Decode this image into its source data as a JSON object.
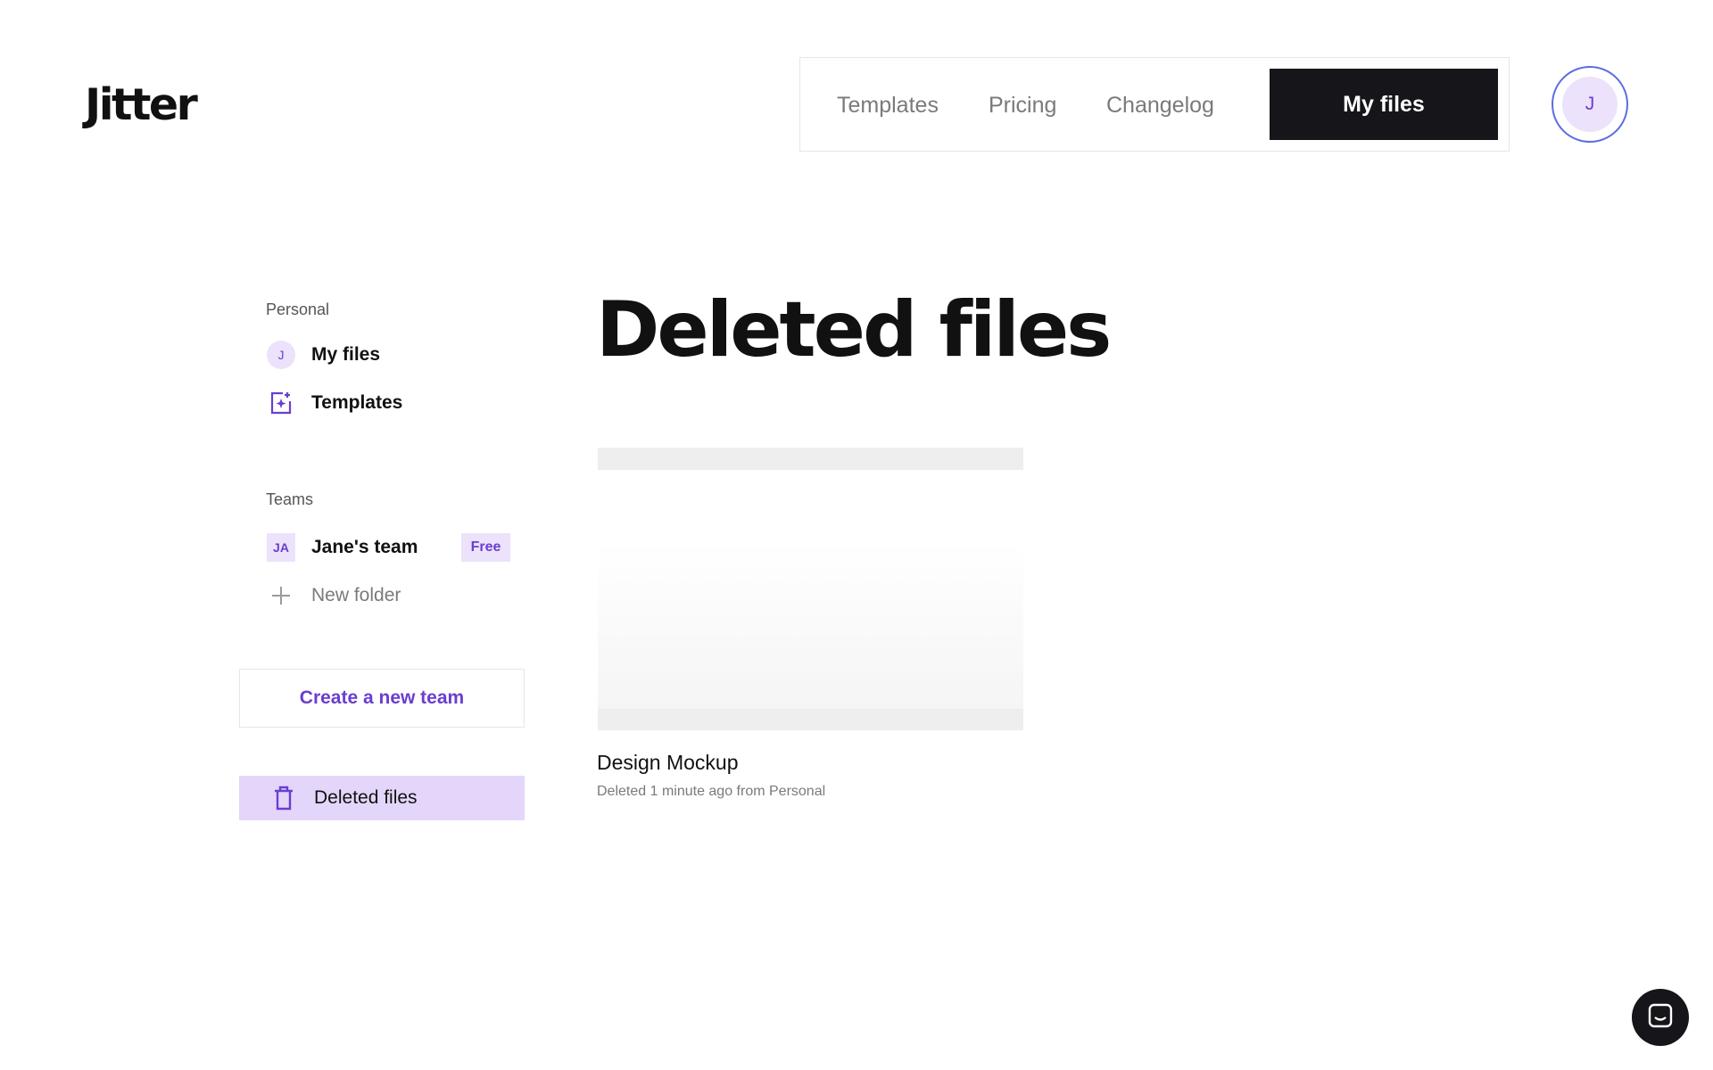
{
  "header": {
    "logo": "Jitter",
    "nav": {
      "templates": "Templates",
      "pricing": "Pricing",
      "changelog": "Changelog",
      "my_files": "My files"
    },
    "avatar_initial": "J"
  },
  "sidebar": {
    "personal_label": "Personal",
    "my_files": {
      "initial": "J",
      "label": "My files"
    },
    "templates": {
      "label": "Templates"
    },
    "teams_label": "Teams",
    "team": {
      "initials": "JA",
      "label": "Jane's team",
      "badge": "Free"
    },
    "new_folder": "New folder",
    "create_team": "Create a new team",
    "deleted_files": "Deleted files"
  },
  "main": {
    "title": "Deleted files",
    "files": [
      {
        "name": "Design Mockup",
        "meta": "Deleted 1 minute ago from Personal"
      }
    ]
  },
  "colors": {
    "accent": "#6a3ed0",
    "accent_light": "#ece2fb",
    "active_bg": "#e4d6fb",
    "dark": "#15151a"
  }
}
